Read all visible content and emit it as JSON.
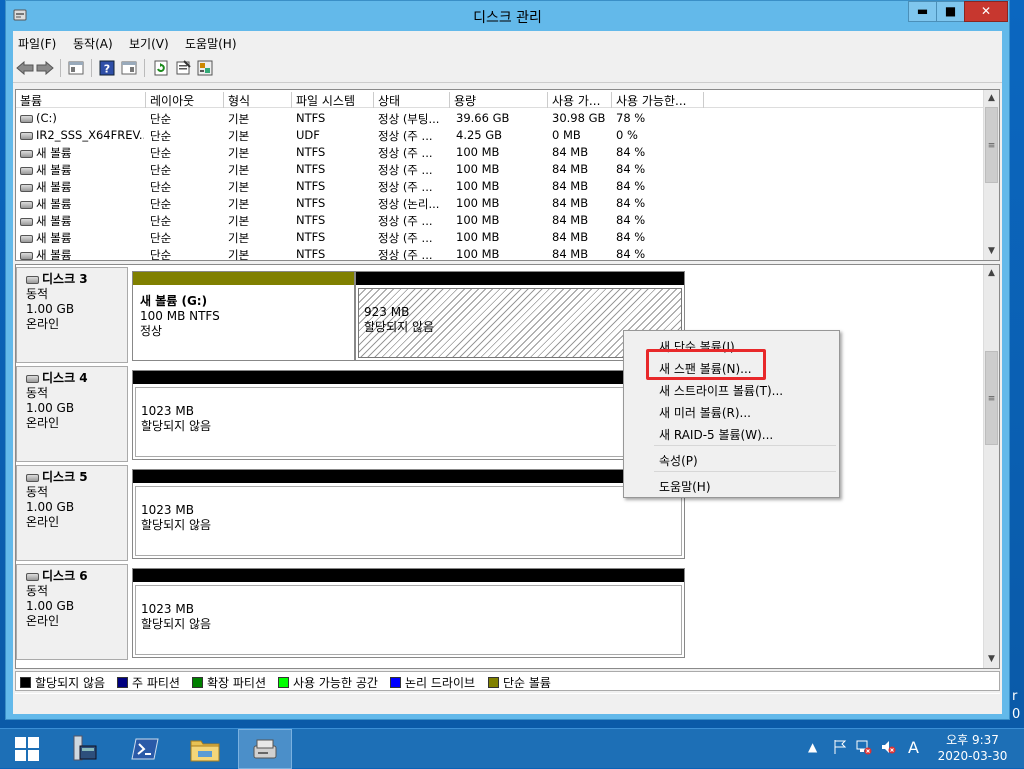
{
  "window": {
    "title": "디스크 관리",
    "min": "▬",
    "max": "■",
    "close": "✕"
  },
  "menu": [
    "파일(F)",
    "동작(A)",
    "보기(V)",
    "도움말(H)"
  ],
  "toolbar_icons": [
    "back-arrow-icon",
    "forward-arrow-icon",
    "console-tree-icon",
    "help-icon",
    "properties-pane-icon",
    "refresh-icon",
    "properties-icon",
    "settings-icon"
  ],
  "volumes": {
    "columns": [
      "볼륨",
      "레이아웃",
      "형식",
      "파일 시스템",
      "상태",
      "용량",
      "사용 가...",
      "사용 가능한..."
    ],
    "rows": [
      [
        "(C:)",
        "단순",
        "기본",
        "NTFS",
        "정상 (부팅...",
        "39.66 GB",
        "30.98 GB",
        "78 %"
      ],
      [
        "IR2_SSS_X64FREV...",
        "단순",
        "기본",
        "UDF",
        "정상 (주 ...",
        "4.25 GB",
        "0 MB",
        "0 %"
      ],
      [
        "새 볼륨",
        "단순",
        "기본",
        "NTFS",
        "정상 (주 ...",
        "100 MB",
        "84 MB",
        "84 %"
      ],
      [
        "새 볼륨",
        "단순",
        "기본",
        "NTFS",
        "정상 (주 ...",
        "100 MB",
        "84 MB",
        "84 %"
      ],
      [
        "새 볼륨",
        "단순",
        "기본",
        "NTFS",
        "정상 (주 ...",
        "100 MB",
        "84 MB",
        "84 %"
      ],
      [
        "새 볼륨",
        "단순",
        "기본",
        "NTFS",
        "정상 (논리...",
        "100 MB",
        "84 MB",
        "84 %"
      ],
      [
        "새 볼륨",
        "단순",
        "기본",
        "NTFS",
        "정상 (주 ...",
        "100 MB",
        "84 MB",
        "84 %"
      ],
      [
        "새 볼륨",
        "단순",
        "기본",
        "NTFS",
        "정상 (주 ...",
        "100 MB",
        "84 MB",
        "84 %"
      ],
      [
        "새 볼륨",
        "단순",
        "기본",
        "NTFS",
        "정상 (주 ...",
        "100 MB",
        "84 MB",
        "84 %"
      ]
    ]
  },
  "disks": [
    {
      "name": "디스크 3",
      "type": "동적",
      "size": "1.00 GB",
      "status": "온라인",
      "partitions": [
        {
          "title": "새 볼륨  (G:)",
          "line1": "100 MB NTFS",
          "line2": "정상"
        },
        {
          "title": "",
          "line1": "923 MB",
          "line2": "할당되지 않음"
        }
      ]
    },
    {
      "name": "디스크 4",
      "type": "동적",
      "size": "1.00 GB",
      "status": "온라인",
      "partitions": [
        {
          "title": "",
          "line1": "1023 MB",
          "line2": "할당되지 않음"
        }
      ]
    },
    {
      "name": "디스크 5",
      "type": "동적",
      "size": "1.00 GB",
      "status": "온라인",
      "partitions": [
        {
          "title": "",
          "line1": "1023 MB",
          "line2": "할당되지 않음"
        }
      ]
    },
    {
      "name": "디스크 6",
      "type": "동적",
      "size": "1.00 GB",
      "status": "온라인",
      "partitions": [
        {
          "title": "",
          "line1": "1023 MB",
          "line2": "할당되지 않음"
        }
      ]
    }
  ],
  "legend": [
    {
      "label": "할당되지 않음",
      "color": "#000000"
    },
    {
      "label": "주 파티션",
      "color": "#00007f"
    },
    {
      "label": "확장 파티션",
      "color": "#007f00"
    },
    {
      "label": "사용 가능한 공간",
      "color": "#00ff00"
    },
    {
      "label": "논리 드라이브",
      "color": "#0000ff"
    },
    {
      "label": "단순 볼륨",
      "color": "#808000"
    }
  ],
  "context_menu": [
    "새 단순 볼륨(I)...",
    "새 스팬 볼륨(N)...",
    "새 스트라이프 볼륨(T)...",
    "새 미러 볼륨(R)...",
    "새 RAID-5 볼륨(W)...",
    "속성(P)",
    "도움말(H)"
  ],
  "colors": {
    "simple_volume": "#808000",
    "unallocated": "#000000",
    "highlight": "#e8282a",
    "taskbar": "#1d6fb6"
  },
  "taskbar": {
    "apps": [
      "start-icon",
      "server-manager-icon",
      "powershell-icon",
      "file-explorer-icon",
      "disk-management-icon"
    ]
  },
  "tray": {
    "time": "오후 9:37",
    "date": "2020-03-30",
    "ime": "A"
  },
  "edge_text": {
    "line1": "r",
    "line2": "0"
  }
}
